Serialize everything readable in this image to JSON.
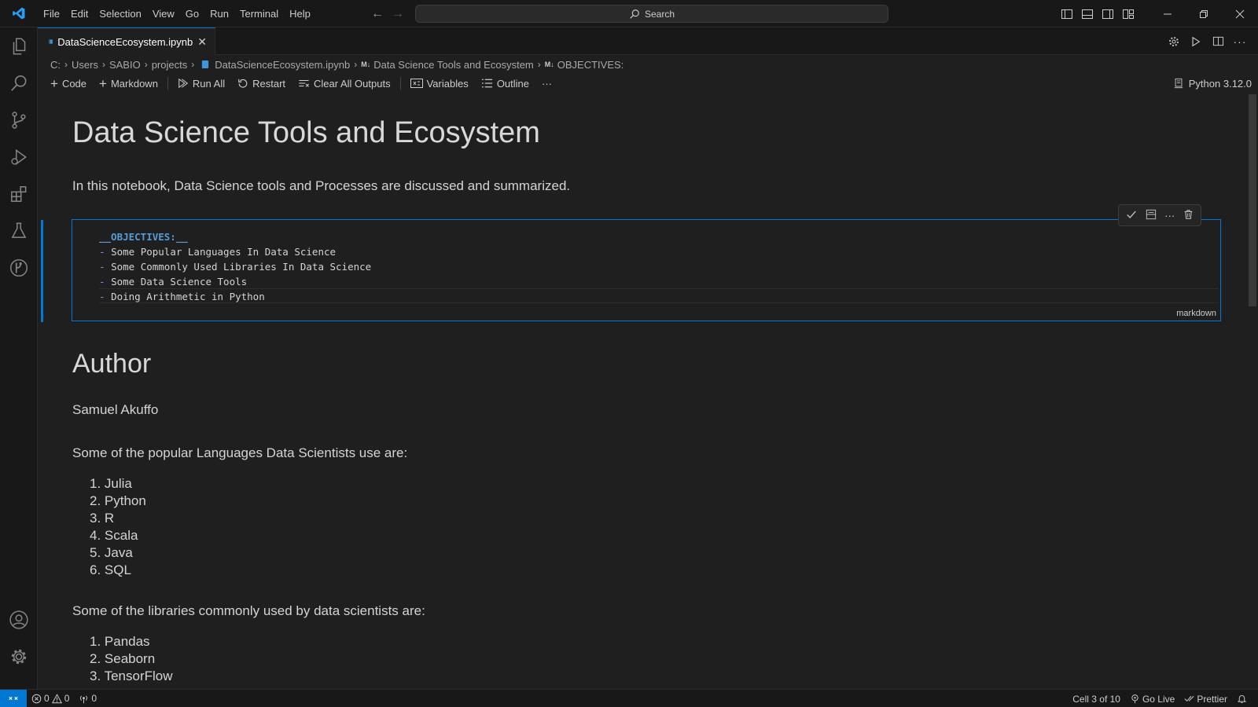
{
  "menu": [
    "File",
    "Edit",
    "Selection",
    "View",
    "Go",
    "Run",
    "Terminal",
    "Help"
  ],
  "search": {
    "label": "Search"
  },
  "tab": {
    "title": "DataScienceEcosystem.ipynb"
  },
  "breadcrumb": {
    "drive": "C:",
    "users": "Users",
    "user": "SABIO",
    "folder": "projects",
    "file": "DataScienceEcosystem.ipynb",
    "md_prefix": "M↓",
    "heading": "Data Science Tools and Ecosystem",
    "section": "OBJECTIVES:"
  },
  "toolbar": {
    "code": "Code",
    "markdown": "Markdown",
    "run_all": "Run All",
    "restart": "Restart",
    "clear_outputs": "Clear All Outputs",
    "variables": "Variables",
    "outline": "Outline",
    "more": "···",
    "kernel": "Python 3.12.0"
  },
  "notebook": {
    "title": "Data Science Tools and Ecosystem",
    "intro": "In this notebook, Data Science tools and Processes are discussed and summarized.",
    "cell_code": {
      "line1": "__OBJECTIVES:__",
      "line2": "Some Popular Languages In Data Science",
      "line3": "Some Commonly Used Libraries In Data Science",
      "line4": "Some Data Science Tools",
      "line5": "Doing Arithmetic in Python"
    },
    "bullet": "-",
    "cell_lang": "markdown",
    "author_heading": "Author",
    "author_name": "Samuel Akuffo",
    "languages_intro": "Some of the popular Languages Data Scientists use are:",
    "languages": [
      "1. Julia",
      "2. Python",
      "3. R",
      "4. Scala",
      "5. Java",
      "6. SQL"
    ],
    "libraries_intro": "Some of the libraries commonly used by data scientists are:",
    "libraries": [
      "1. Pandas",
      "2. Seaborn",
      "3. TensorFlow"
    ]
  },
  "statusbar": {
    "errors": "0",
    "warnings": "0",
    "ports": "0",
    "cell": "Cell 3 of 10",
    "golive": "Go Live",
    "prettier": "Prettier"
  },
  "colors": {
    "accent": "#0078d4",
    "background": "#1f1f1f",
    "chrome": "#181818"
  }
}
